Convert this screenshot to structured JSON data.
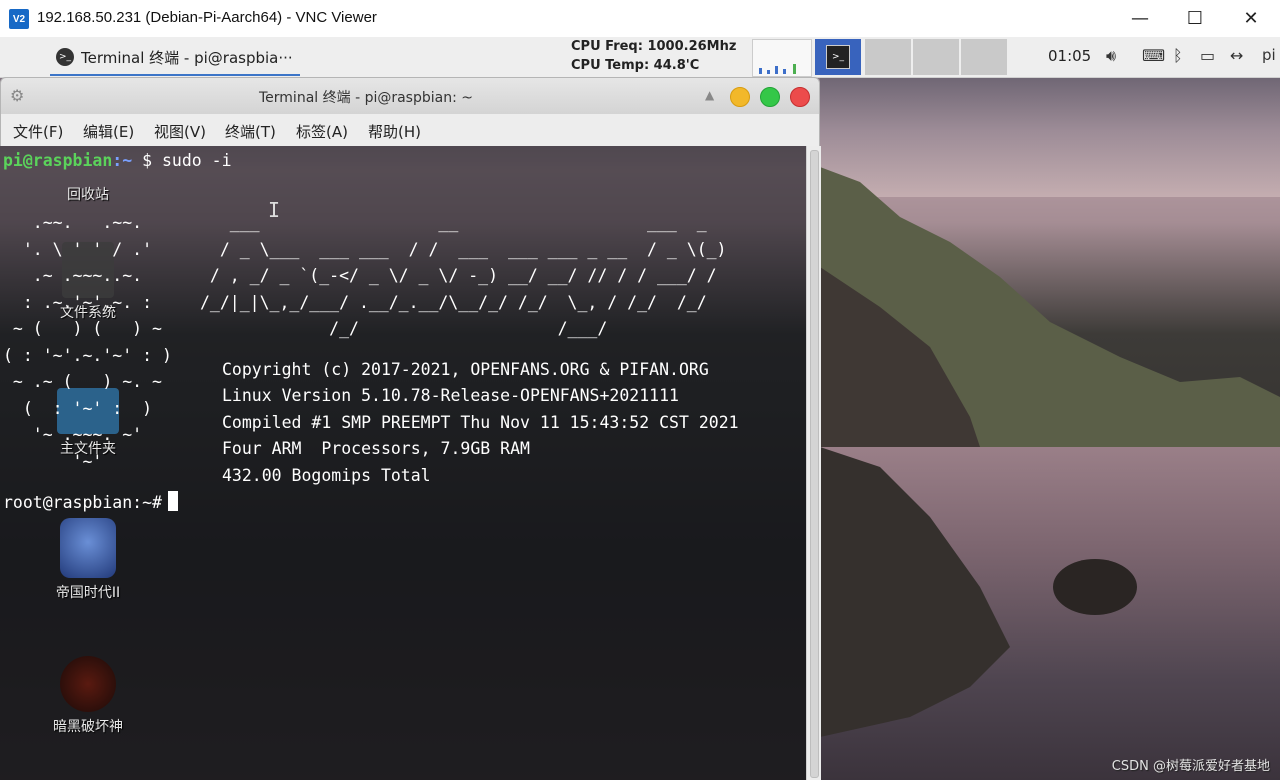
{
  "vnc": {
    "title": "192.168.50.231 (Debian-Pi-Aarch64) - VNC Viewer",
    "logo": "V2",
    "minimize": "—",
    "maximize": "☐",
    "close": "✕"
  },
  "panel": {
    "task_label": "Terminal 终端 - pi@raspbia···",
    "cpu_freq": "CPU Freq: 1000.26Mhz",
    "cpu_temp": "CPU Temp: 44.8'C",
    "clock": "01:05",
    "tray_last": "pi",
    "icons": [
      "apple-icon",
      "terminal-icon",
      "volume-icon",
      "keyboard-icon",
      "bluetooth-icon",
      "battery-icon",
      "network-icon"
    ]
  },
  "terminal": {
    "title": "Terminal 终端 - pi@raspbian: ~",
    "menu": [
      "文件(F)",
      "编辑(E)",
      "视图(V)",
      "终端(T)",
      "标签(A)",
      "帮助(H)"
    ],
    "prompt1_user": "pi@raspbian",
    "prompt1_path": ":~",
    "prompt1_cmd": "$ sudo -i",
    "logo_art": "   ___                  __                   ___  _\n  / _ \\___  ___ ___  / /  ___  ___ ___ _ __  / _ \\(_)\n / , _/ _ `(_-</ _ \\/ _ \\/ -_) __/ __/ // / / ___/ /\n/_/|_|\\_,_/___/ .__/_.__/\\__/_/ /_/  \\_, / /_/  /_/\n             /_/                    /___/",
    "left_art": "   .~~.   .~~.\n  '. \\ ' ' / .'\n   .~ .~~~..~.\n  : .~.'~'.~. :\n ~ (   ) (   ) ~\n( : '~'.~.'~' : )\n ~ .~ (   ) ~. ~\n  (  : '~' :  )\n   '~ .~~~. ~'\n       '~'",
    "info": [
      "Copyright (c) 2017-2021, OPENFANS.ORG & PIFAN.ORG",
      "Linux Version 5.10.78-Release-OPENFANS+2021111",
      "Compiled #1 SMP PREEMPT Thu Nov 11 15:43:52 CST 2021",
      "Four ARM  Processors, 7.9GB RAM",
      "432.00 Bogomips Total"
    ],
    "root_prompt": "root@raspbian:~#"
  },
  "desktop_icons": [
    {
      "label": "回收站"
    },
    {
      "label": "文件系统"
    },
    {
      "label": "主文件夹"
    },
    {
      "label": "帝国时代II"
    },
    {
      "label": "暗黑破坏神"
    }
  ],
  "watermark": "CSDN @树莓派爱好者基地"
}
